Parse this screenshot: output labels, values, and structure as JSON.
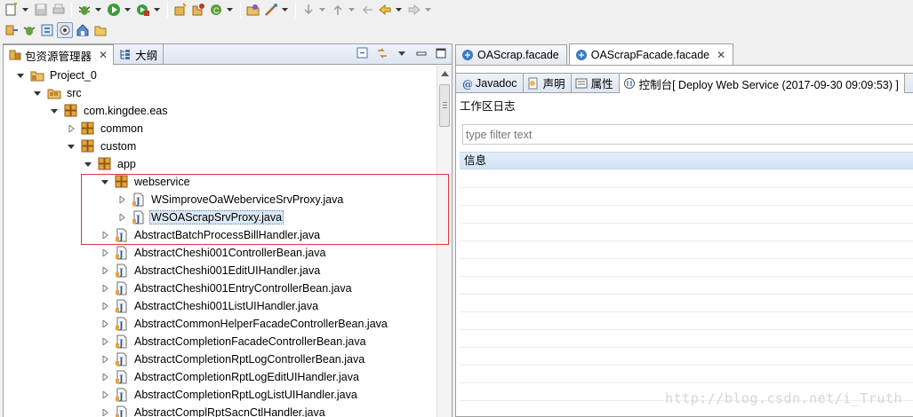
{
  "toolbar_main": {
    "buttons": [
      "new-icon",
      "save-icon",
      "print-icon",
      "debug-icon",
      "run-icon",
      "external-tools-icon",
      "new-java-package-icon",
      "new-class-icon",
      "refresh-icon",
      "open-type-icon",
      "run-last-icon",
      "next-annotation-icon",
      "previous-annotation-icon",
      "last-edit-icon",
      "back-icon",
      "forward-icon"
    ]
  },
  "toolbar_secondary": {
    "buttons": [
      "ear-icon",
      "bug-icon",
      "sync-icon",
      "perspective-icon",
      "home-icon",
      "folder-icon"
    ]
  },
  "left_view": {
    "tabs": [
      {
        "label": "包资源管理器",
        "icon": "package-explorer-icon",
        "active": true
      },
      {
        "label": "大纲",
        "icon": "outline-icon",
        "active": false
      }
    ]
  },
  "tree": {
    "items": [
      {
        "label": "Project_0",
        "depth": 0,
        "expanded": true,
        "type": "project"
      },
      {
        "label": "src",
        "depth": 1,
        "expanded": true,
        "type": "source-folder"
      },
      {
        "label": "com.kingdee.eas",
        "depth": 2,
        "expanded": true,
        "type": "package"
      },
      {
        "label": "common",
        "depth": 3,
        "expanded": false,
        "type": "package"
      },
      {
        "label": "custom",
        "depth": 3,
        "expanded": true,
        "type": "package"
      },
      {
        "label": "app",
        "depth": 4,
        "expanded": true,
        "type": "package"
      },
      {
        "label": "webservice",
        "depth": 5,
        "expanded": true,
        "type": "package"
      },
      {
        "label": "WSimproveOaWeberviceSrvProxy.java",
        "depth": 6,
        "expanded": false,
        "type": "java"
      },
      {
        "label": "WSOAScrapSrvProxy.java",
        "depth": 6,
        "expanded": false,
        "type": "java",
        "selected": true
      },
      {
        "label": "AbstractBatchProcessBillHandler.java",
        "depth": 5,
        "expanded": false,
        "type": "java"
      },
      {
        "label": "AbstractCheshi001ControllerBean.java",
        "depth": 5,
        "expanded": false,
        "type": "java"
      },
      {
        "label": "AbstractCheshi001EditUIHandler.java",
        "depth": 5,
        "expanded": false,
        "type": "java"
      },
      {
        "label": "AbstractCheshi001EntryControllerBean.java",
        "depth": 5,
        "expanded": false,
        "type": "java"
      },
      {
        "label": "AbstractCheshi001ListUIHandler.java",
        "depth": 5,
        "expanded": false,
        "type": "java"
      },
      {
        "label": "AbstractCommonHelperFacadeControllerBean.java",
        "depth": 5,
        "expanded": false,
        "type": "java"
      },
      {
        "label": "AbstractCompletionFacadeControllerBean.java",
        "depth": 5,
        "expanded": false,
        "type": "java"
      },
      {
        "label": "AbstractCompletionRptLogControllerBean.java",
        "depth": 5,
        "expanded": false,
        "type": "java"
      },
      {
        "label": "AbstractCompletionRptLogEditUIHandler.java",
        "depth": 5,
        "expanded": false,
        "type": "java"
      },
      {
        "label": "AbstractCompletionRptLogListUIHandler.java",
        "depth": 5,
        "expanded": false,
        "type": "java"
      },
      {
        "label": "AbstractComplRptSacnCtlHandler.java",
        "depth": 5,
        "expanded": false,
        "type": "java"
      }
    ]
  },
  "editor_tabs": [
    {
      "label": "OAScrap.facade",
      "icon": "facade-icon",
      "active": false
    },
    {
      "label": "OAScrapFacade.facade",
      "icon": "facade-icon",
      "active": true
    }
  ],
  "console_view": {
    "tabs": [
      {
        "label": "Javadoc",
        "icon": "javadoc-icon",
        "active": false
      },
      {
        "label": "声明",
        "icon": "declaration-icon",
        "active": false
      },
      {
        "label": "属性",
        "icon": "properties-icon",
        "active": false
      },
      {
        "label": "控制台[  Deploy Web Service (2017-09-30 09:09:53) ]",
        "icon": "console-icon",
        "active": true
      }
    ],
    "title": "工作区日志",
    "filter_placeholder": "type filter text",
    "column_header": "信息"
  },
  "watermark": "http://blog.csdn.net/i_Truth",
  "colors": {
    "highlight_box": "#e0373e",
    "package_icon": "#c9822a",
    "selection": "#dde8f5"
  }
}
